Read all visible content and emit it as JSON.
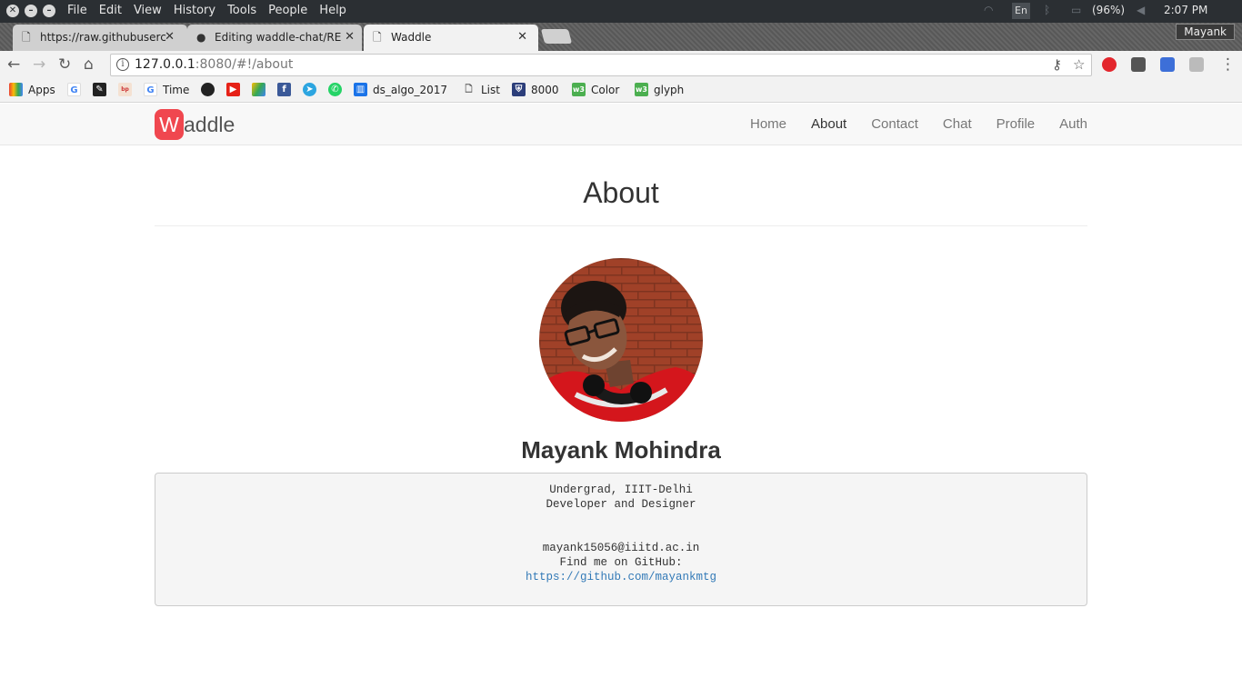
{
  "os": {
    "menu": [
      "File",
      "Edit",
      "View",
      "History",
      "Tools",
      "People",
      "Help"
    ],
    "lang": "En",
    "battery": "(96%)",
    "clock": "2:07 PM"
  },
  "tabs": [
    {
      "label": "https://raw.githubuserc",
      "icon": "page-icon"
    },
    {
      "label": "Editing waddle-chat/RE",
      "icon": "github-icon"
    },
    {
      "label": "Waddle",
      "icon": "page-icon"
    }
  ],
  "profile_name": "Mayank",
  "address": {
    "host": "127.0.0.1",
    "rest": ":8080/#!/about"
  },
  "bookmarks": [
    "Apps",
    "Time",
    "ds_algo_2017",
    "List",
    "8000",
    "Color",
    "glyph"
  ],
  "site": {
    "brand_first": "W",
    "brand_rest": "addle",
    "nav": [
      "Home",
      "About",
      "Contact",
      "Chat",
      "Profile",
      "Auth"
    ],
    "active_nav": "About",
    "title": "About",
    "name": "Mayank Mohindra",
    "info": {
      "line1": "Undergrad, IIIT-Delhi",
      "line2": "Developer and Designer",
      "email": "mayank15056@iiitd.ac.in",
      "github_label": "Find me on GitHub:",
      "github_url": "https://github.com/mayankmtg"
    }
  }
}
